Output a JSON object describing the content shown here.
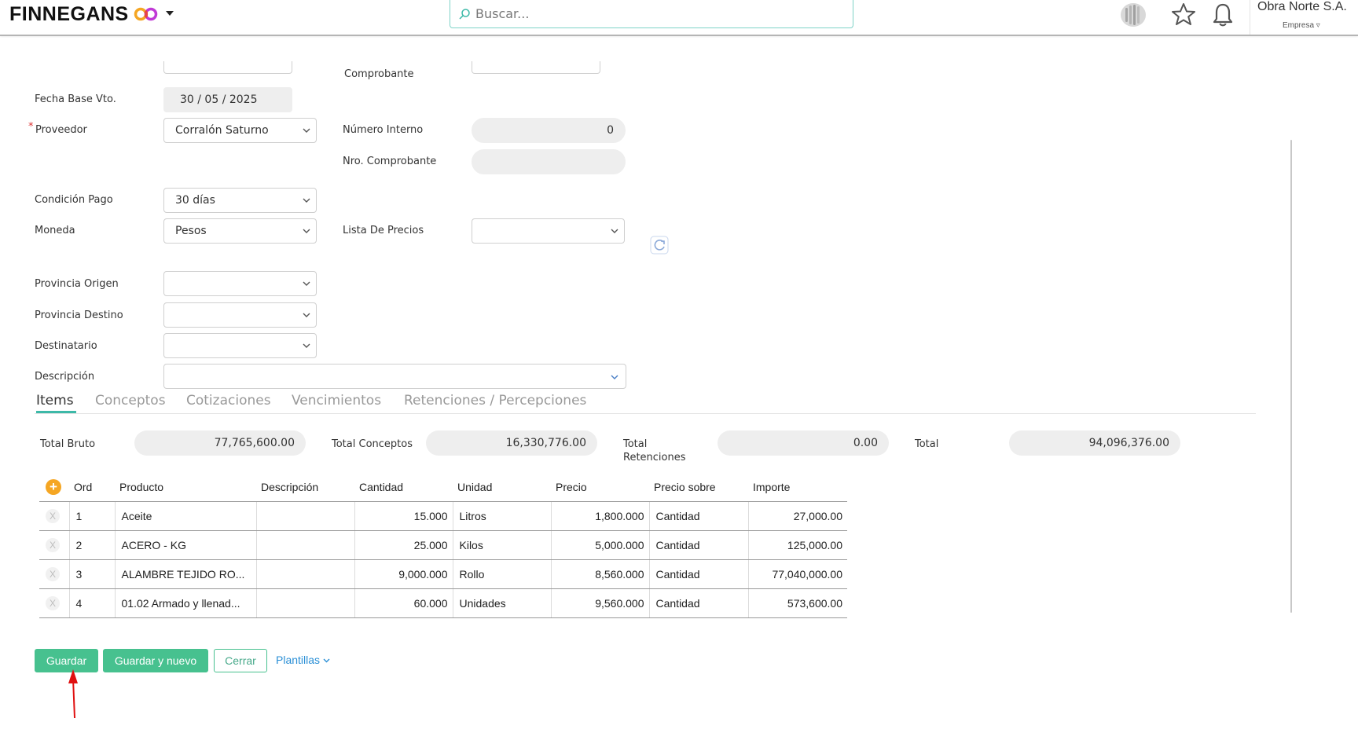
{
  "header": {
    "brand": "FINNEGANS",
    "search_placeholder": "Buscar...",
    "company_name": "Obra Norte S.A.",
    "company_selector": "Empresa ▿"
  },
  "form": {
    "comprobante_label": "Comprobante",
    "fecha_base_vto_label": "Fecha Base Vto.",
    "fecha_base_vto_value": "30 / 05 / 2025",
    "proveedor_label": "Proveedor",
    "proveedor_value": "Corralón Saturno",
    "numero_interno_label": "Número Interno",
    "numero_interno_value": "0",
    "nro_comprobante_label": "Nro. Comprobante",
    "nro_comprobante_value": "",
    "condicion_pago_label": "Condición Pago",
    "condicion_pago_value": "30 días",
    "moneda_label": "Moneda",
    "moneda_value": "Pesos",
    "lista_precios_label": "Lista De Precios",
    "lista_precios_value": "",
    "provincia_origen_label": "Provincia Origen",
    "provincia_destino_label": "Provincia Destino",
    "destinatario_label": "Destinatario",
    "descripcion_label": "Descripción"
  },
  "tabs": [
    "Items",
    "Conceptos",
    "Cotizaciones",
    "Vencimientos",
    "Retenciones / Percepciones"
  ],
  "totals": {
    "bruto_label": "Total Bruto",
    "bruto_value": "77,765,600.00",
    "conceptos_label": "Total Conceptos",
    "conceptos_value": "16,330,776.00",
    "retenciones_label_1": "Total",
    "retenciones_label_2": "Retenciones",
    "retenciones_value": "0.00",
    "total_label": "Total",
    "total_value": "94,096,376.00"
  },
  "table": {
    "headers": [
      "Ord",
      "Producto",
      "Descripción",
      "Cantidad",
      "Unidad",
      "Precio",
      "Precio sobre",
      "Importe"
    ],
    "rows": [
      {
        "ord": "1",
        "producto": "Aceite",
        "descripcion": "",
        "cantidad": "15.000",
        "unidad": "Litros",
        "precio": "1,800.000",
        "precio_sobre": "Cantidad",
        "importe": "27,000.00"
      },
      {
        "ord": "2",
        "producto": "ACERO - KG",
        "descripcion": "",
        "cantidad": "25.000",
        "unidad": "Kilos",
        "precio": "5,000.000",
        "precio_sobre": "Cantidad",
        "importe": "125,000.00"
      },
      {
        "ord": "3",
        "producto": "ALAMBRE TEJIDO RO...",
        "descripcion": "",
        "cantidad": "9,000.000",
        "unidad": "Rollo",
        "precio": "8,560.000",
        "precio_sobre": "Cantidad",
        "importe": "77,040,000.00"
      },
      {
        "ord": "4",
        "producto": "01.02 Armado y llenad...",
        "descripcion": "",
        "cantidad": "60.000",
        "unidad": "Unidades",
        "precio": "9,560.000",
        "precio_sobre": "Cantidad",
        "importe": "573,600.00"
      }
    ]
  },
  "actions": {
    "guardar": "Guardar",
    "guardar_nuevo": "Guardar y nuevo",
    "cerrar": "Cerrar",
    "plantillas": "Plantillas"
  },
  "colors": {
    "accent": "#47c18f",
    "tab_active": "#3db9a8",
    "link": "#2a8fd6",
    "add_button": "#f5a623",
    "annotation_arrow": "#e01010"
  }
}
